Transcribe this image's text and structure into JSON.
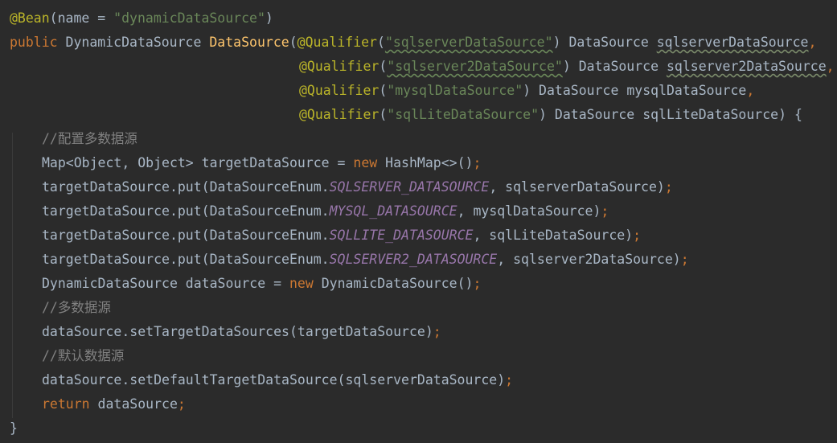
{
  "code": {
    "bean_annotation": "@Bean",
    "bean_param": "name",
    "bean_value": "\"dynamicDataSource\"",
    "public_kw": "public",
    "return_type": "DynamicDataSource",
    "method_name": "DataSource",
    "qualifier": "@Qualifier",
    "datasource_type": "DataSource",
    "q1_value": "\"sqlserverDataSource\"",
    "p1_name": "sqlserverDataSource",
    "q2_value": "\"sqlserver2DataSource\"",
    "p2_name": "sqlserver2DataSource",
    "q3_value": "\"mysqlDataSource\"",
    "p3_name": "mysqlDataSource",
    "q4_value": "\"sqlLiteDataSource\"",
    "p4_name": "sqlLiteDataSource",
    "comment1": "//配置多数据源",
    "map_decl": "Map<Object, Object> targetDataSource = ",
    "new_kw": "new",
    "hashmap_init": " HashMap<>()",
    "put_call": "targetDataSource.put(DataSourceEnum.",
    "c1": "SQLSERVER_DATASOURCE",
    "a1": ", sqlserverDataSource)",
    "c2": "MYSQL_DATASOURCE",
    "a2": ", mysqlDataSource)",
    "c3": "SQLLITE_DATASOURCE",
    "a3": ", sqlLiteDataSource)",
    "c4": "SQLSERVER2_DATASOURCE",
    "a4": ", sqlserver2DataSource)",
    "dds_decl": "DynamicDataSource dataSource = ",
    "dds_ctor": " DynamicDataSource()",
    "comment2": "//多数据源",
    "set_target": "dataSource.setTargetDataSources(targetDataSource)",
    "comment3": "//默认数据源",
    "set_default": "dataSource.setDefaultTargetDataSource(sqlserverDataSource)",
    "return_kw": "return",
    "return_val": " dataSource",
    "semicolon": ";",
    "open_paren": "(",
    "close_paren": ")",
    "close_params": ") {",
    "equals": " = ",
    "comma": ",",
    "comma_space": ", ",
    "space": " ",
    "close_brace": "}"
  }
}
